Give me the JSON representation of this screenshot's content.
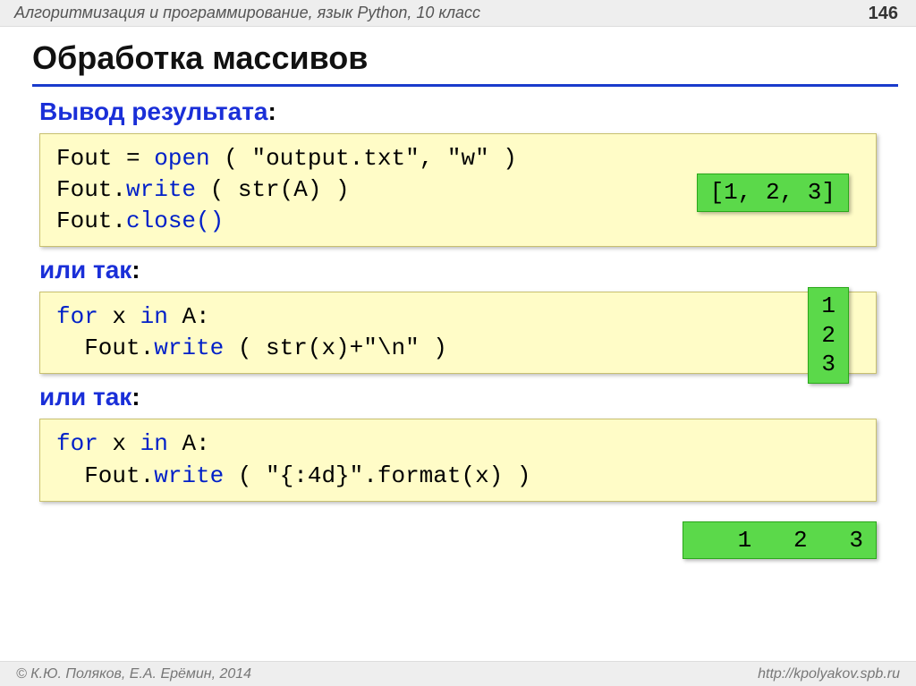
{
  "header": {
    "course": "Алгоритмизация и программирование, язык Python, 10 класс",
    "page": "146"
  },
  "title": "Обработка массивов",
  "sections": {
    "s1_label": "Вывод результата",
    "s2_label": "или так",
    "s3_label": "или так"
  },
  "code1": {
    "l1a": "Fout",
    "l1b": " =",
    "l1c": " open",
    "l1d": " ( \"output.txt\", \"w\" )",
    "l2a": "Fout.",
    "l2b": "write",
    "l2c": " ( str(A) )",
    "l3a": "Fout.",
    "l3b": "close()"
  },
  "out1": "[1, 2, 3]",
  "code2": {
    "l1a": "for",
    "l1b": " x ",
    "l1c": "in",
    "l1d": " A:",
    "l2a": "  Fout.",
    "l2b": "write",
    "l2c": " ( str(x)+\"\\n\" )"
  },
  "out2": "1\n2\n3",
  "code3": {
    "l1a": "for",
    "l1b": " x ",
    "l1c": "in",
    "l1d": " A:",
    "l2a": "  Fout.",
    "l2b": "write",
    "l2c": " ( \"{:4d}\".format(x) )"
  },
  "out3": "   1   2   3",
  "footer": {
    "left": "© К.Ю. Поляков, Е.А. Ерёмин, 2014",
    "right": "http://kpolyakov.spb.ru"
  }
}
